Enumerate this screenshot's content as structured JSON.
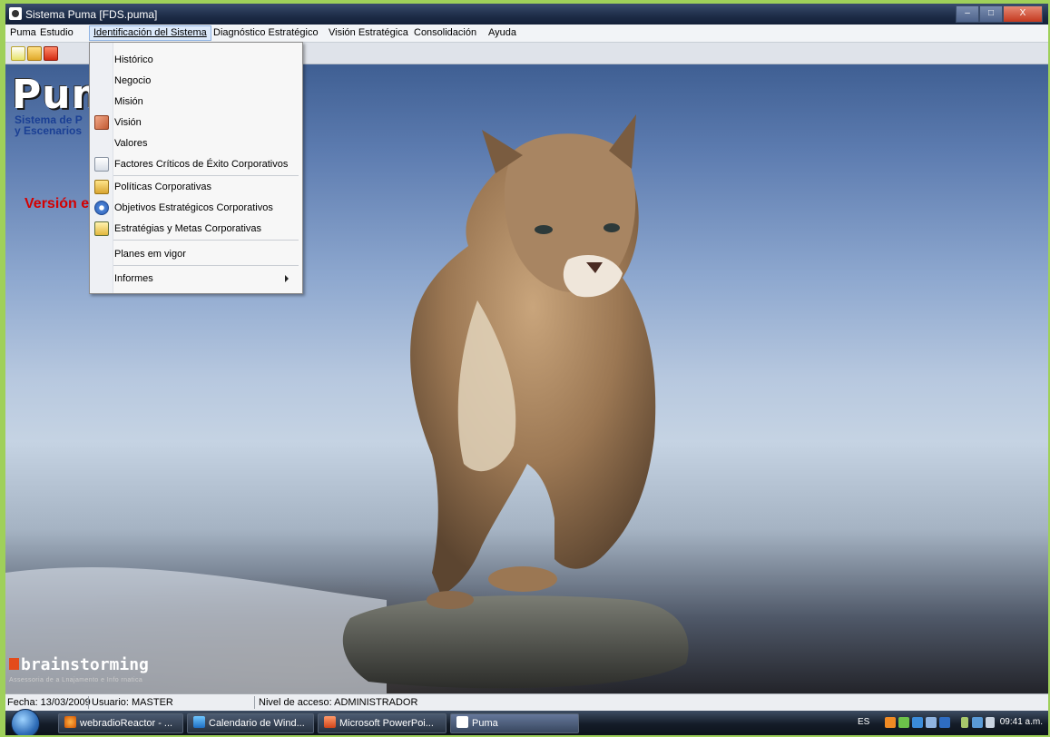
{
  "window": {
    "title": "Sistema Puma [FDS.puma]",
    "min_glyph": "–",
    "max_glyph": "□",
    "close_glyph": "X"
  },
  "menubar": {
    "items": [
      "Puma",
      "Estudio",
      "Identificación del Sistema",
      "Diagnóstico Estratégico",
      "Visión Estratégica",
      "Consolidación",
      "Ayuda"
    ],
    "active_item": "Identificación del Sistema"
  },
  "toolbar": {
    "buttons": [
      "new-icon",
      "open-folder-icon",
      "close-file-icon"
    ]
  },
  "splash": {
    "logo": "Puma",
    "subtitle_line1": "Sistema de P",
    "subtitle_line2": "y Escenarios",
    "version": "Versión e",
    "brand": "brainstorming",
    "brand_tagline": "Assessoria de a Lnajamento e Info rnatica"
  },
  "dropdown": {
    "items": [
      {
        "label": "Histórico",
        "icon": ""
      },
      {
        "label": "Negocio",
        "icon": ""
      },
      {
        "label": "Misión",
        "icon": ""
      },
      {
        "label": "Visión",
        "icon": "vision-icon"
      },
      {
        "label": "Valores",
        "icon": ""
      },
      {
        "label": "Factores Críticos de Éxito Corporativos",
        "icon": "critical-factors-icon"
      },
      {
        "label": "Políticas Corporativas",
        "icon": "policies-icon"
      },
      {
        "label": "Objetivos Estratégicos Corporativos",
        "icon": "objectives-icon"
      },
      {
        "label": "Estratégias y Metas Corporativas",
        "icon": "strategies-icon"
      },
      {
        "label": "Planes em vigor",
        "icon": ""
      },
      {
        "label": "Informes",
        "icon": "",
        "submenu": true
      }
    ]
  },
  "statusbar": {
    "fecha": "Fecha: 13/03/2009",
    "usuario": "Usuario: MASTER",
    "nivel": "Nivel de acceso: ADMINISTRADOR"
  },
  "taskbar": {
    "buttons": [
      {
        "label": "webradioReactor - ...",
        "icon": "firefox-icon"
      },
      {
        "label": "Calendario de Wind...",
        "icon": "calendar-icon"
      },
      {
        "label": "Microsoft PowerPoi...",
        "icon": "powerpoint-icon"
      },
      {
        "label": "Puma",
        "icon": "puma-app-icon"
      }
    ],
    "language": "ES",
    "clock": "09:41 a.m."
  },
  "colors": {
    "version_red": "#d40000",
    "subtitle_blue": "#1a3f94",
    "brand_orange": "#e34b1b"
  }
}
